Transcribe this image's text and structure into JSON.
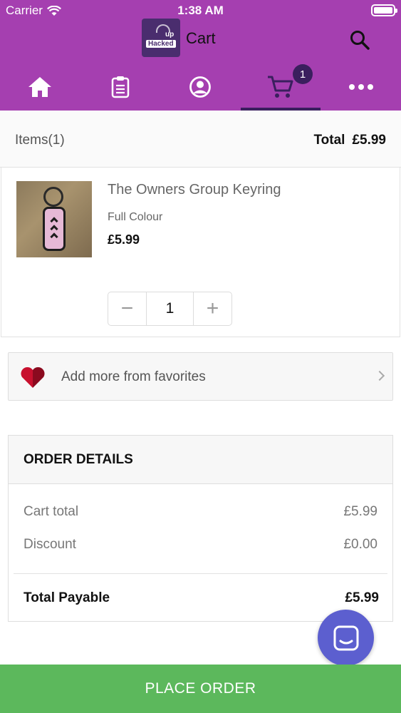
{
  "status_bar": {
    "carrier": "Carrier",
    "time": "1:38 AM"
  },
  "header": {
    "title": "Cart",
    "logo_text": "Hacked",
    "logo_superscript": "up",
    "color": "#a53fb0",
    "active_tab_color": "#3a1f5e"
  },
  "tabs": [
    {
      "icon": "home-icon"
    },
    {
      "icon": "clipboard-icon"
    },
    {
      "icon": "profile-icon"
    },
    {
      "icon": "cart-icon",
      "active": true,
      "badge": "1"
    },
    {
      "icon": "more-icon"
    }
  ],
  "summary": {
    "items_label": "Items(1)",
    "total_label": "Total",
    "total_value": "£5.99"
  },
  "cart_items": [
    {
      "name": "The Owners Group Keyring",
      "variant": "Full Colour",
      "price": "£5.99",
      "quantity": "1"
    }
  ],
  "stepper": {
    "minus": "−",
    "plus": "+"
  },
  "favorites": {
    "label": "Add more from favorites"
  },
  "order_details": {
    "heading": "ORDER DETAILS",
    "lines": [
      {
        "label": "Cart total",
        "value": "£5.99"
      },
      {
        "label": "Discount",
        "value": "£0.00"
      }
    ],
    "total": {
      "label": "Total Payable",
      "value": "£5.99"
    }
  },
  "actions": {
    "place_order": "PLACE ORDER",
    "place_order_color": "#5cb85c",
    "chat_color": "#5c5fcf"
  }
}
